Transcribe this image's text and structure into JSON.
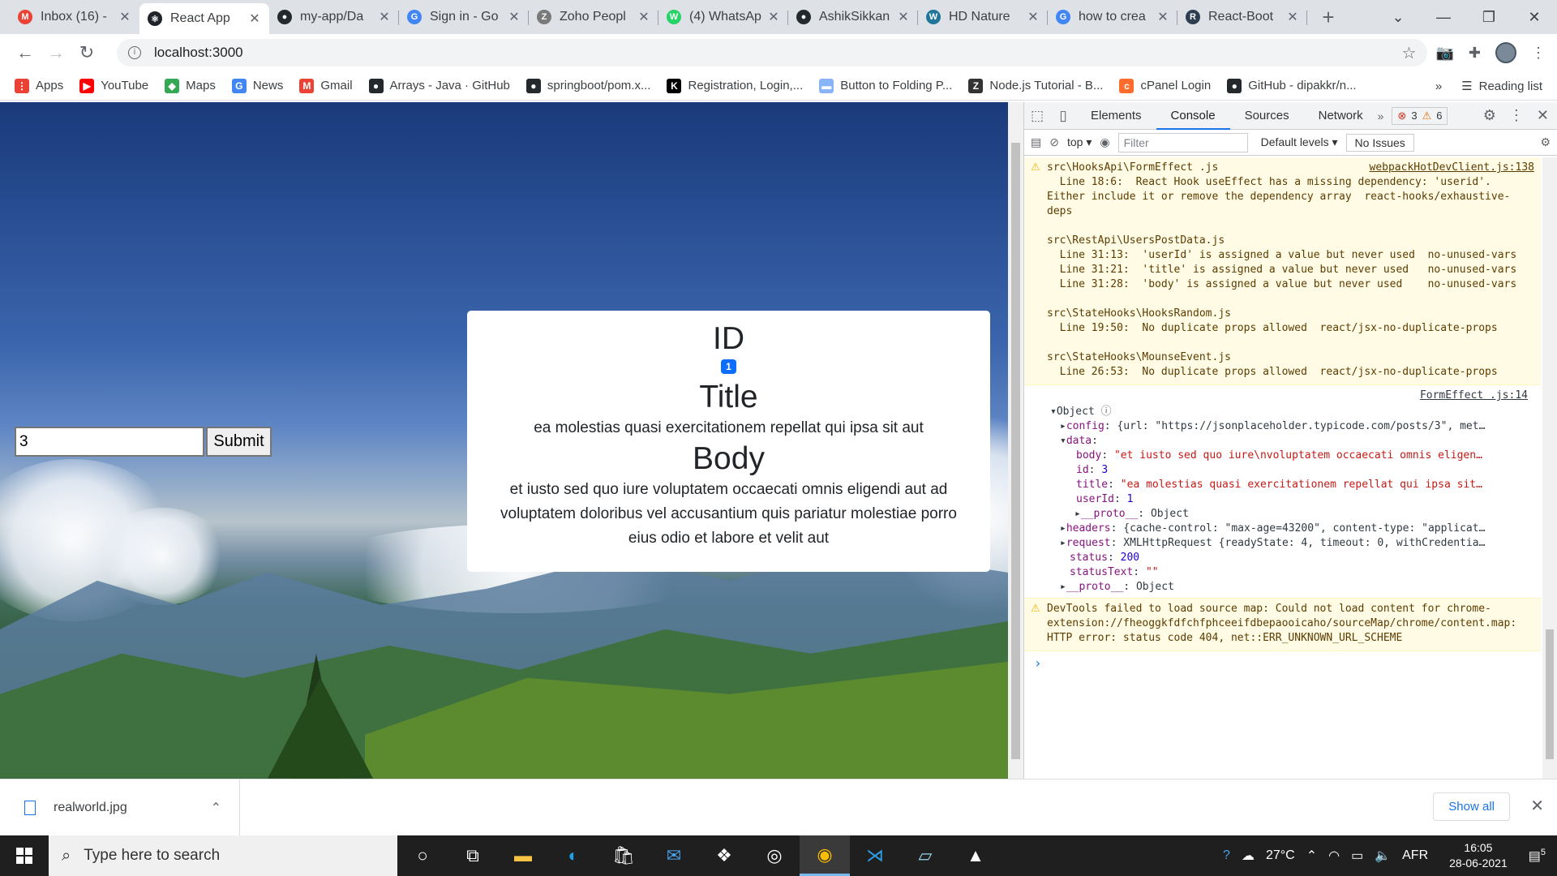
{
  "browser": {
    "tabs": [
      {
        "title": "Inbox (16) -",
        "icon": "gmail-icon",
        "color": "#ea4335",
        "glyph": "M"
      },
      {
        "title": "React App",
        "icon": "react-icon",
        "color": "#20232a",
        "glyph": "⚛"
      },
      {
        "title": "my-app/Da",
        "icon": "github-icon",
        "color": "#24292e",
        "glyph": "●"
      },
      {
        "title": "Sign in - Go",
        "icon": "google-icon",
        "color": "#4285f4",
        "glyph": "G"
      },
      {
        "title": "Zoho Peopl",
        "icon": "zoho-icon",
        "color": "#7a7a7a",
        "glyph": "Z"
      },
      {
        "title": "(4) WhatsAp",
        "icon": "whatsapp-icon",
        "color": "#25d366",
        "glyph": "W"
      },
      {
        "title": "AshikSikkan",
        "icon": "github-icon",
        "color": "#24292e",
        "glyph": "●"
      },
      {
        "title": "HD Nature",
        "icon": "wordpress-icon",
        "color": "#21759b",
        "glyph": "W"
      },
      {
        "title": "how to crea",
        "icon": "google-icon",
        "color": "#4285f4",
        "glyph": "G"
      },
      {
        "title": "React-Boot",
        "icon": "react-bootstrap-icon",
        "color": "#2c3e50",
        "glyph": "R"
      }
    ],
    "url": "localhost:3000",
    "bookmarks": [
      {
        "label": "Apps",
        "color": "#ea4335",
        "glyph": "⋮"
      },
      {
        "label": "YouTube",
        "color": "#ff0000",
        "glyph": "▶"
      },
      {
        "label": "Maps",
        "color": "#34a853",
        "glyph": "◆"
      },
      {
        "label": "News",
        "color": "#4285f4",
        "glyph": "G"
      },
      {
        "label": "Gmail",
        "color": "#ea4335",
        "glyph": "M"
      },
      {
        "label": "Arrays - Java · GitHub",
        "color": "#24292e",
        "glyph": "●"
      },
      {
        "label": "springboot/pom.x...",
        "color": "#24292e",
        "glyph": "●"
      },
      {
        "label": "Registration, Login,...",
        "color": "#000000",
        "glyph": "K"
      },
      {
        "label": "Button to Folding P...",
        "color": "#8ab4f8",
        "glyph": "▬"
      },
      {
        "label": "Node.js Tutorial - B...",
        "color": "#333333",
        "glyph": "Z"
      },
      {
        "label": "cPanel Login",
        "color": "#ff6c2c",
        "glyph": "c"
      },
      {
        "label": "GitHub - dipakkr/n...",
        "color": "#24292e",
        "glyph": "●"
      }
    ],
    "reading_list": "Reading list"
  },
  "app": {
    "input_value": "3",
    "submit_label": "Submit",
    "card": {
      "id_heading": "ID",
      "id_value": "1",
      "title_heading": "Title",
      "title_text": "ea molestias quasi exercitationem repellat qui ipsa sit aut",
      "body_heading": "Body",
      "body_text": "et iusto sed quo iure voluptatem occaecati omnis eligendi aut ad voluptatem doloribus vel accusantium quis pariatur molestiae porro eius odio et labore et velit aut"
    }
  },
  "devtools": {
    "tabs": [
      "Elements",
      "Console",
      "Sources",
      "Network"
    ],
    "active_tab": "Console",
    "error_count": "3",
    "warning_count": "6",
    "context": "top",
    "filter_placeholder": "Filter",
    "levels": "Default levels",
    "issues": "No Issues",
    "warning1": {
      "link": "webpackHotDevClient.js:138",
      "text": "src\\HooksApi\\FormEffect .js\n  Line 18:6:  React Hook useEffect has a missing dependency: 'userid'. Either include it or remove the dependency array  react-hooks/exhaustive-deps\n\nsrc\\RestApi\\UsersPostData.js\n  Line 31:13:  'userId' is assigned a value but never used  no-unused-vars\n  Line 31:21:  'title' is assigned a value but never used   no-unused-vars\n  Line 31:28:  'body' is assigned a value but never used    no-unused-vars\n\nsrc\\StateHooks\\HooksRandom.js\n  Line 19:50:  No duplicate props allowed  react/jsx-no-duplicate-props\n\nsrc\\StateHooks\\MounseEvent.js\n  Line 26:53:  No duplicate props allowed  react/jsx-no-duplicate-props"
    },
    "log_source": "FormEffect .js:14",
    "object": {
      "label": "Object",
      "config_key": "config",
      "config_val": "{url: \"https://jsonplaceholder.typicode.com/posts/3\", met…",
      "data_key": "data",
      "body_key": "body",
      "body_val": "\"et iusto sed quo iure\\nvoluptatem occaecati omnis eligen…",
      "id_key": "id",
      "id_val": "3",
      "title_key": "title",
      "title_val": "\"ea molestias quasi exercitationem repellat qui ipsa sit…",
      "userid_key": "userId",
      "userid_val": "1",
      "proto_key": "__proto__",
      "proto_val": "Object",
      "headers_key": "headers",
      "headers_val": "{cache-control: \"max-age=43200\", content-type: \"applicat…",
      "request_key": "request",
      "request_val": "XMLHttpRequest {readyState: 4, timeout: 0, withCredentia…",
      "status_key": "status",
      "status_val": "200",
      "statustext_key": "statusText",
      "statustext_val": "\"\""
    },
    "warning2": "DevTools failed to load source map: Could not load content for chrome-extension://fheoggkfdfchfphceeifdbepaooicaho/sourceMap/chrome/content.map: HTTP error: status code 404, net::ERR_UNKNOWN_URL_SCHEME"
  },
  "downloads": {
    "file": "realworld.jpg",
    "show_all": "Show all"
  },
  "taskbar": {
    "search_placeholder": "Type here to search",
    "temperature": "27°C",
    "language": "AFR",
    "time": "16:05",
    "date": "28-06-2021",
    "notifications": "5"
  }
}
